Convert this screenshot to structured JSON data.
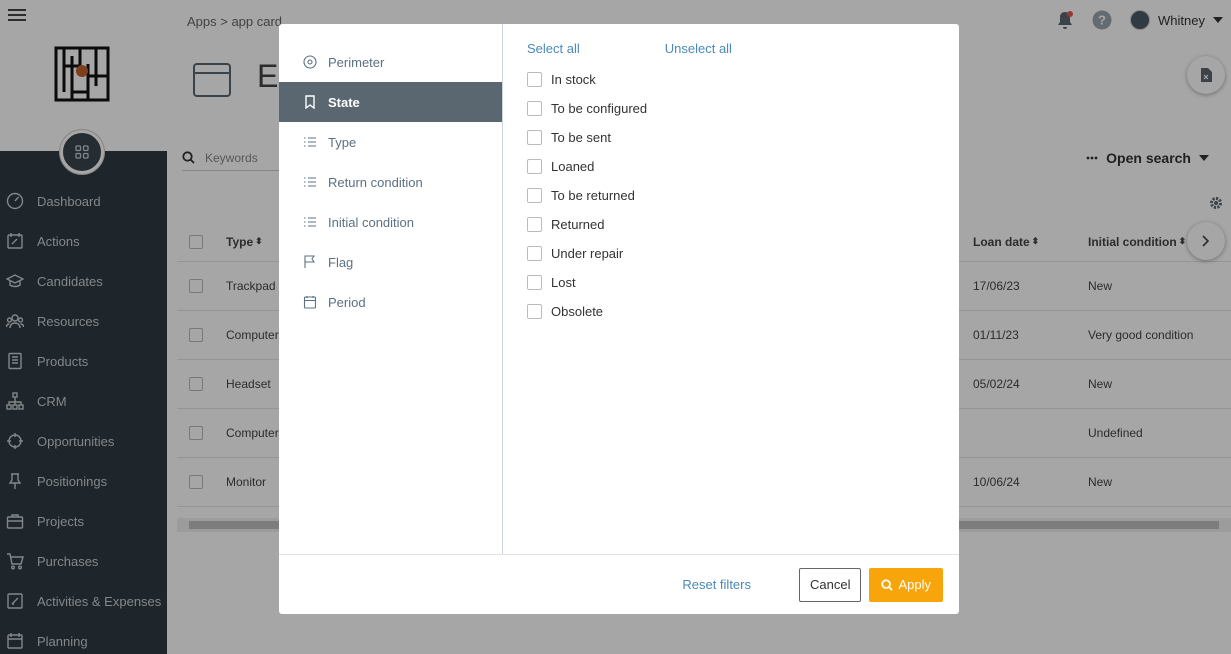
{
  "sidebar": {
    "items": [
      {
        "label": "Dashboard",
        "icon": "gauge-icon"
      },
      {
        "label": "Actions",
        "icon": "calendar-edit-icon"
      },
      {
        "label": "Candidates",
        "icon": "graduation-cap-icon"
      },
      {
        "label": "Resources",
        "icon": "users-icon"
      },
      {
        "label": "Products",
        "icon": "book-icon"
      },
      {
        "label": "CRM",
        "icon": "org-chart-icon"
      },
      {
        "label": "Opportunities",
        "icon": "crosshair-icon"
      },
      {
        "label": "Positionings",
        "icon": "pin-icon"
      },
      {
        "label": "Projects",
        "icon": "briefcase-icon"
      },
      {
        "label": "Purchases",
        "icon": "cart-icon"
      },
      {
        "label": "Activities & Expenses",
        "icon": "edit-doc-icon"
      },
      {
        "label": "Planning",
        "icon": "calendar-icon"
      }
    ]
  },
  "header": {
    "breadcrumb": "Apps > app card",
    "title": "E",
    "user_name": "Whitney"
  },
  "toolbar": {
    "search_placeholder": "Keywords",
    "open_search": "Open search"
  },
  "table": {
    "columns": {
      "type": "Type",
      "loan_date": "Loan date",
      "initial_condition": "Initial condition"
    },
    "rows": [
      {
        "type": "Trackpad",
        "loan_date": "17/06/23",
        "initial_condition": "New"
      },
      {
        "type": "Computer",
        "loan_date": "01/11/23",
        "initial_condition": "Very good condition"
      },
      {
        "type": "Headset",
        "loan_date": "05/02/24",
        "initial_condition": "New"
      },
      {
        "type": "Computer",
        "loan_date": "",
        "initial_condition": "Undefined"
      },
      {
        "type": "Monitor",
        "loan_date": "10/06/24",
        "initial_condition": "New"
      }
    ]
  },
  "modal": {
    "filters": [
      {
        "label": "Perimeter",
        "icon": "target-icon"
      },
      {
        "label": "State",
        "icon": "bookmark-icon",
        "active": true
      },
      {
        "label": "Type",
        "icon": "list-icon"
      },
      {
        "label": "Return condition",
        "icon": "list-icon"
      },
      {
        "label": "Initial condition",
        "icon": "list-icon"
      },
      {
        "label": "Flag",
        "icon": "flag-icon"
      },
      {
        "label": "Period",
        "icon": "calendar-icon"
      }
    ],
    "select_all": "Select all",
    "unselect_all": "Unselect all",
    "options": [
      {
        "label": "In stock",
        "checked": false
      },
      {
        "label": "To be configured",
        "checked": false
      },
      {
        "label": "To be sent",
        "checked": false
      },
      {
        "label": "Loaned",
        "checked": false
      },
      {
        "label": "To be returned",
        "checked": false
      },
      {
        "label": "Returned",
        "checked": false
      },
      {
        "label": "Under repair",
        "checked": false
      },
      {
        "label": "Lost",
        "checked": false
      },
      {
        "label": "Obsolete",
        "checked": false
      }
    ],
    "reset_filters": "Reset filters",
    "cancel": "Cancel",
    "apply": "Apply"
  },
  "colors": {
    "sidebar_bg": "#2f3a42",
    "active_filter_bg": "#5b6770",
    "link": "#4a8ab8",
    "apply_button": "#f7a50a"
  }
}
